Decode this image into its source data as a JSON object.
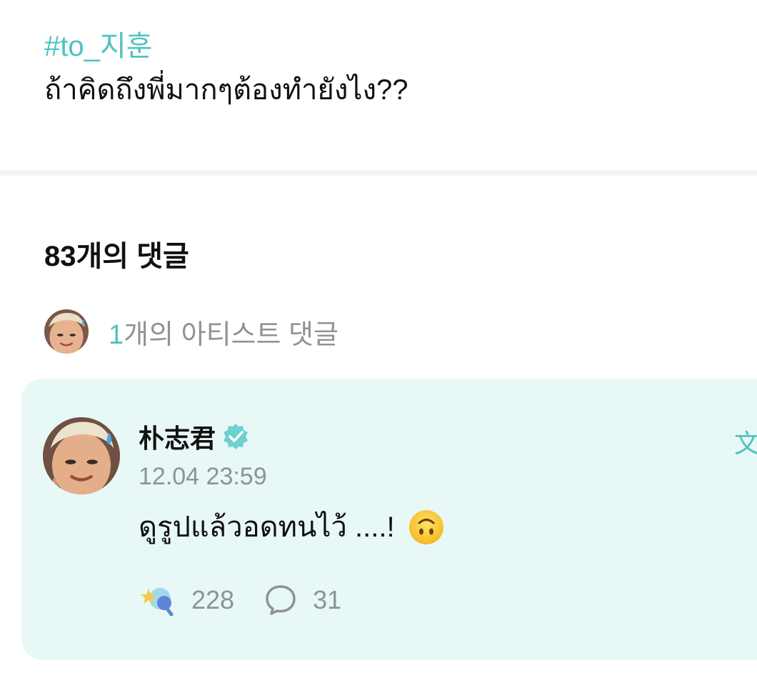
{
  "post": {
    "hashtag": "#to_지훈",
    "text": "ถ้าคิดถึงพี่มากๆต้องทำยังไง??"
  },
  "comments": {
    "heading": "83개의 댓글",
    "artist_count_number": "1",
    "artist_count_label": "개의 아티스트 댓글"
  },
  "comment": {
    "author": "朴志君",
    "timestamp": "12.04 23:59",
    "body": "ดูรูปแล้วอดทนไว้ ....!",
    "translate_label": "文",
    "like_count": "228",
    "reply_count": "31"
  },
  "icons": {
    "verified": "verified-badge-icon",
    "emoji": "upside-down-face-emoji",
    "like": "star-reaction-icon",
    "reply": "speech-bubble-icon",
    "translate": "translate-icon"
  },
  "colors": {
    "accent": "#4ec3c3",
    "card_background": "#e8f8f6",
    "muted_text": "#8f9393",
    "divider": "#f3f4f4"
  }
}
